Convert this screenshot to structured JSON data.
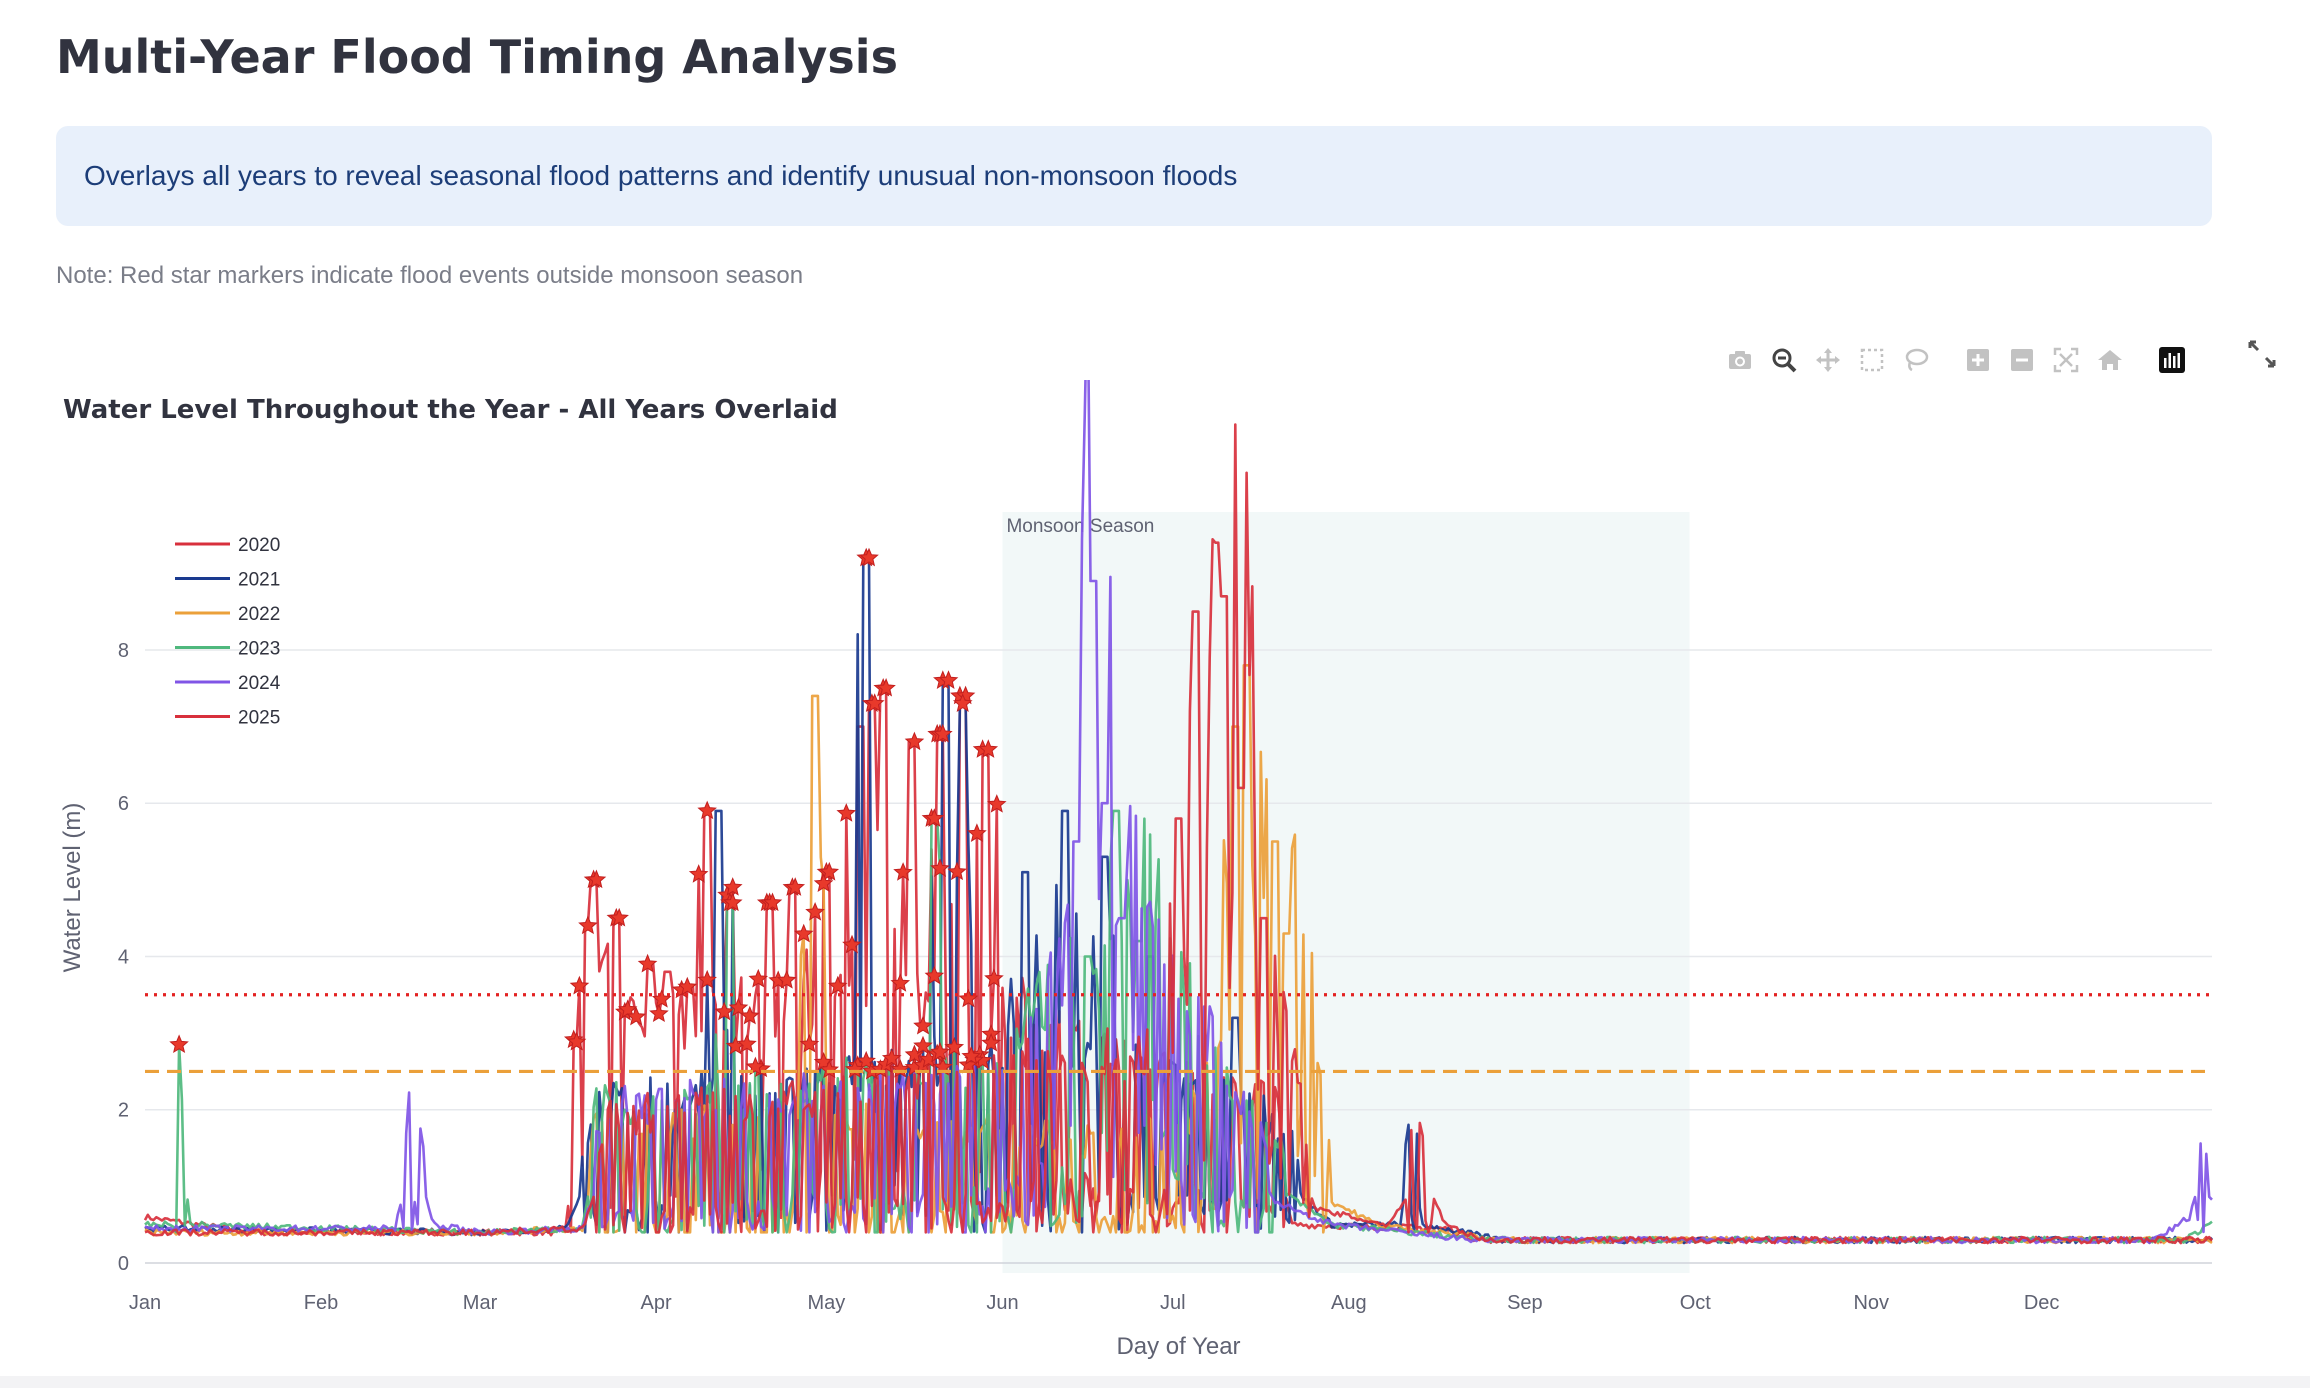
{
  "page": {
    "title": "Multi-Year Flood Timing Analysis",
    "info": "Overlays all years to reveal seasonal flood patterns and identify unusual non-monsoon floods",
    "note": "Note: Red star markers indicate flood events outside monsoon season"
  },
  "toolbar": {
    "icons": [
      "camera-icon",
      "zoom-icon",
      "pan-icon",
      "box-select-icon",
      "lasso-icon",
      "zoom-in-icon",
      "zoom-out-icon",
      "autoscale-icon",
      "reset-axes-icon",
      "plotly-logo-icon"
    ],
    "fullscreen_icon": "fullscreen-icon"
  },
  "chart_data": {
    "type": "line",
    "title": "Water Level Throughout the Year - All Years Overlaid",
    "xlabel": "Day of Year",
    "ylabel": "Water Level (m)",
    "xlim": [
      1,
      365
    ],
    "ylim": [
      0,
      9.8
    ],
    "yticks": [
      0,
      2,
      4,
      6,
      8
    ],
    "month_ticks": [
      {
        "label": "Jan",
        "day": 1
      },
      {
        "label": "Feb",
        "day": 32
      },
      {
        "label": "Mar",
        "day": 60
      },
      {
        "label": "Apr",
        "day": 91
      },
      {
        "label": "May",
        "day": 121
      },
      {
        "label": "Jun",
        "day": 152
      },
      {
        "label": "Jul",
        "day": 182
      },
      {
        "label": "Aug",
        "day": 213
      },
      {
        "label": "Sep",
        "day": 244
      },
      {
        "label": "Oct",
        "day": 274
      },
      {
        "label": "Nov",
        "day": 305
      },
      {
        "label": "Dec",
        "day": 335
      }
    ],
    "grid": true,
    "legend_position": "top-left",
    "monsoon_band": {
      "label": "Monsoon Season",
      "start_day": 152,
      "end_day": 273,
      "color": "#f2f8f8"
    },
    "thresholds": [
      {
        "value": 3.5,
        "color": "#e32222",
        "dash": "3,6"
      },
      {
        "value": 2.5,
        "color": "#eba03a",
        "dash": "14,8"
      }
    ],
    "star_marker_color": "#e8392b",
    "series": [
      {
        "name": "2020",
        "color": "#d8303c",
        "baseline": [
          [
            1,
            0.6
          ],
          [
            20,
            0.4
          ],
          [
            60,
            0.4
          ],
          [
            75,
            0.4
          ],
          [
            78,
            2.5
          ],
          [
            95,
            2.0
          ],
          [
            150,
            2.2
          ],
          [
            175,
            1.6
          ],
          [
            200,
            1.4
          ],
          [
            203,
            0.5
          ],
          [
            230,
            0.45
          ],
          [
            236,
            0.3
          ],
          [
            365,
            0.3
          ]
        ],
        "peaks": [
          [
            79,
            4.4
          ],
          [
            80,
            5.0
          ],
          [
            84,
            4.5
          ],
          [
            90,
            3.9
          ],
          [
            93,
            3.8
          ],
          [
            97,
            3.6
          ],
          [
            100,
            5.9
          ],
          [
            104,
            4.8
          ],
          [
            111,
            4.7
          ],
          [
            115,
            4.9
          ],
          [
            121,
            5.1
          ],
          [
            127,
            7.0
          ],
          [
            129,
            7.3
          ],
          [
            131,
            7.5
          ],
          [
            136,
            6.8
          ],
          [
            141,
            6.9
          ],
          [
            145,
            7.4
          ],
          [
            149,
            6.7
          ]
        ]
      },
      {
        "name": "2021",
        "color": "#1a3a8f",
        "baseline": [
          [
            1,
            0.45
          ],
          [
            60,
            0.4
          ],
          [
            75,
            0.45
          ],
          [
            80,
            1.3
          ],
          [
            120,
            1.5
          ],
          [
            160,
            1.8
          ],
          [
            200,
            1.2
          ],
          [
            210,
            0.5
          ],
          [
            222,
            0.5
          ],
          [
            224,
            1.4
          ],
          [
            226,
            0.5
          ],
          [
            240,
            0.3
          ],
          [
            365,
            0.3
          ]
        ],
        "peaks": [
          [
            102,
            5.9
          ],
          [
            128,
            9.2
          ],
          [
            142,
            7.6
          ],
          [
            145,
            7.3
          ],
          [
            156,
            5.1
          ],
          [
            163,
            5.9
          ],
          [
            170,
            5.3
          ],
          [
            178,
            4.0
          ],
          [
            193,
            3.2
          ]
        ]
      },
      {
        "name": "2022",
        "color": "#eba03a",
        "baseline": [
          [
            1,
            0.4
          ],
          [
            60,
            0.4
          ],
          [
            78,
            0.45
          ],
          [
            80,
            1.1
          ],
          [
            120,
            1.2
          ],
          [
            170,
            1.0
          ],
          [
            185,
            1.2
          ],
          [
            195,
            2.6
          ],
          [
            200,
            4.0
          ],
          [
            205,
            3.0
          ],
          [
            210,
            0.8
          ],
          [
            218,
            0.5
          ],
          [
            240,
            0.3
          ],
          [
            365,
            0.3
          ]
        ],
        "peaks": [
          [
            119,
            7.4
          ],
          [
            193,
            7.0
          ],
          [
            195,
            7.8
          ],
          [
            200,
            5.5
          ],
          [
            202,
            4.3
          ]
        ]
      },
      {
        "name": "2023",
        "color": "#4fb87d",
        "baseline": [
          [
            1,
            0.5
          ],
          [
            6,
            0.5
          ],
          [
            7,
            1.7
          ],
          [
            9,
            0.5
          ],
          [
            60,
            0.4
          ],
          [
            78,
            0.45
          ],
          [
            80,
            1.3
          ],
          [
            150,
            1.6
          ],
          [
            165,
            2.5
          ],
          [
            178,
            3.5
          ],
          [
            190,
            1.5
          ],
          [
            210,
            0.5
          ],
          [
            238,
            0.3
          ],
          [
            360,
            0.3
          ],
          [
            365,
            0.5
          ]
        ],
        "peaks": [
          [
            104,
            4.7
          ],
          [
            140,
            5.8
          ],
          [
            167,
            4.0
          ],
          [
            172,
            5.9
          ],
          [
            176,
            4.2
          ]
        ]
      },
      {
        "name": "2024",
        "color": "#8055e6",
        "baseline": [
          [
            1,
            0.45
          ],
          [
            45,
            0.45
          ],
          [
            48,
            1.4
          ],
          [
            52,
            0.5
          ],
          [
            60,
            0.4
          ],
          [
            78,
            0.45
          ],
          [
            82,
            1.3
          ],
          [
            150,
            1.5
          ],
          [
            163,
            2.5
          ],
          [
            168,
            8.9
          ],
          [
            172,
            4.0
          ],
          [
            180,
            2.5
          ],
          [
            190,
            1.8
          ],
          [
            200,
            0.8
          ],
          [
            210,
            0.5
          ],
          [
            235,
            0.3
          ],
          [
            355,
            0.3
          ],
          [
            361,
            0.6
          ],
          [
            363,
            1.1
          ],
          [
            365,
            0.8
          ]
        ],
        "peaks": [
          [
            165,
            5.5
          ],
          [
            168,
            8.9
          ],
          [
            170,
            6.0
          ],
          [
            173,
            4.5
          ]
        ]
      },
      {
        "name": "2025",
        "color": "#d8303c",
        "baseline": [
          [
            1,
            0.4
          ],
          [
            60,
            0.4
          ],
          [
            78,
            0.45
          ],
          [
            82,
            1.2
          ],
          [
            150,
            1.6
          ],
          [
            182,
            1.8
          ],
          [
            188,
            2.8
          ],
          [
            190,
            9.4
          ],
          [
            195,
            6.0
          ],
          [
            200,
            2.5
          ],
          [
            207,
            0.7
          ],
          [
            220,
            0.5
          ],
          [
            226,
            1.2
          ],
          [
            230,
            0.5
          ],
          [
            237,
            0.3
          ],
          [
            365,
            0.3
          ]
        ],
        "peaks": [
          [
            183,
            5.8
          ],
          [
            186,
            8.5
          ],
          [
            190,
            9.4
          ],
          [
            191,
            8.7
          ],
          [
            194,
            6.2
          ],
          [
            198,
            4.5
          ]
        ]
      }
    ]
  }
}
